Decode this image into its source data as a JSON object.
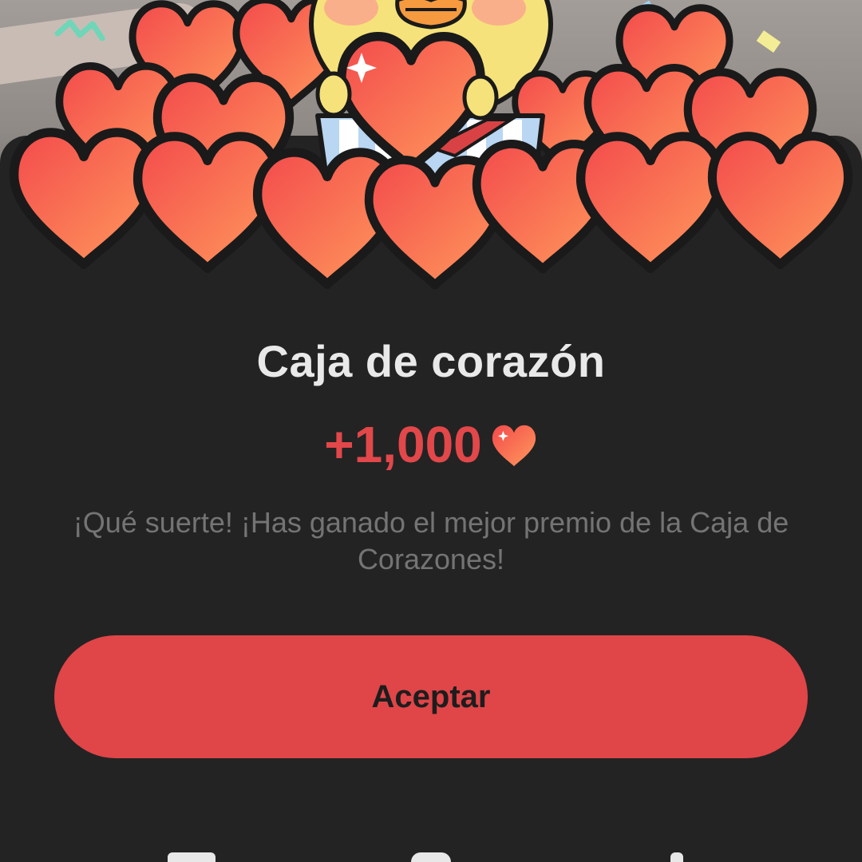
{
  "dialog": {
    "title": "Caja de corazón",
    "reward_amount": "+1,000",
    "reward_icon": "heart-icon",
    "message": "¡Qué suerte! ¡Has ganado el mejor premio de la Caja de Corazones!",
    "accept_label": "Aceptar"
  },
  "colors": {
    "background": "#232323",
    "accent": "#e04548",
    "title": "#e9e9e9",
    "message": "#747474",
    "heart_light": "#ff9860",
    "heart_dark": "#f0484c"
  }
}
